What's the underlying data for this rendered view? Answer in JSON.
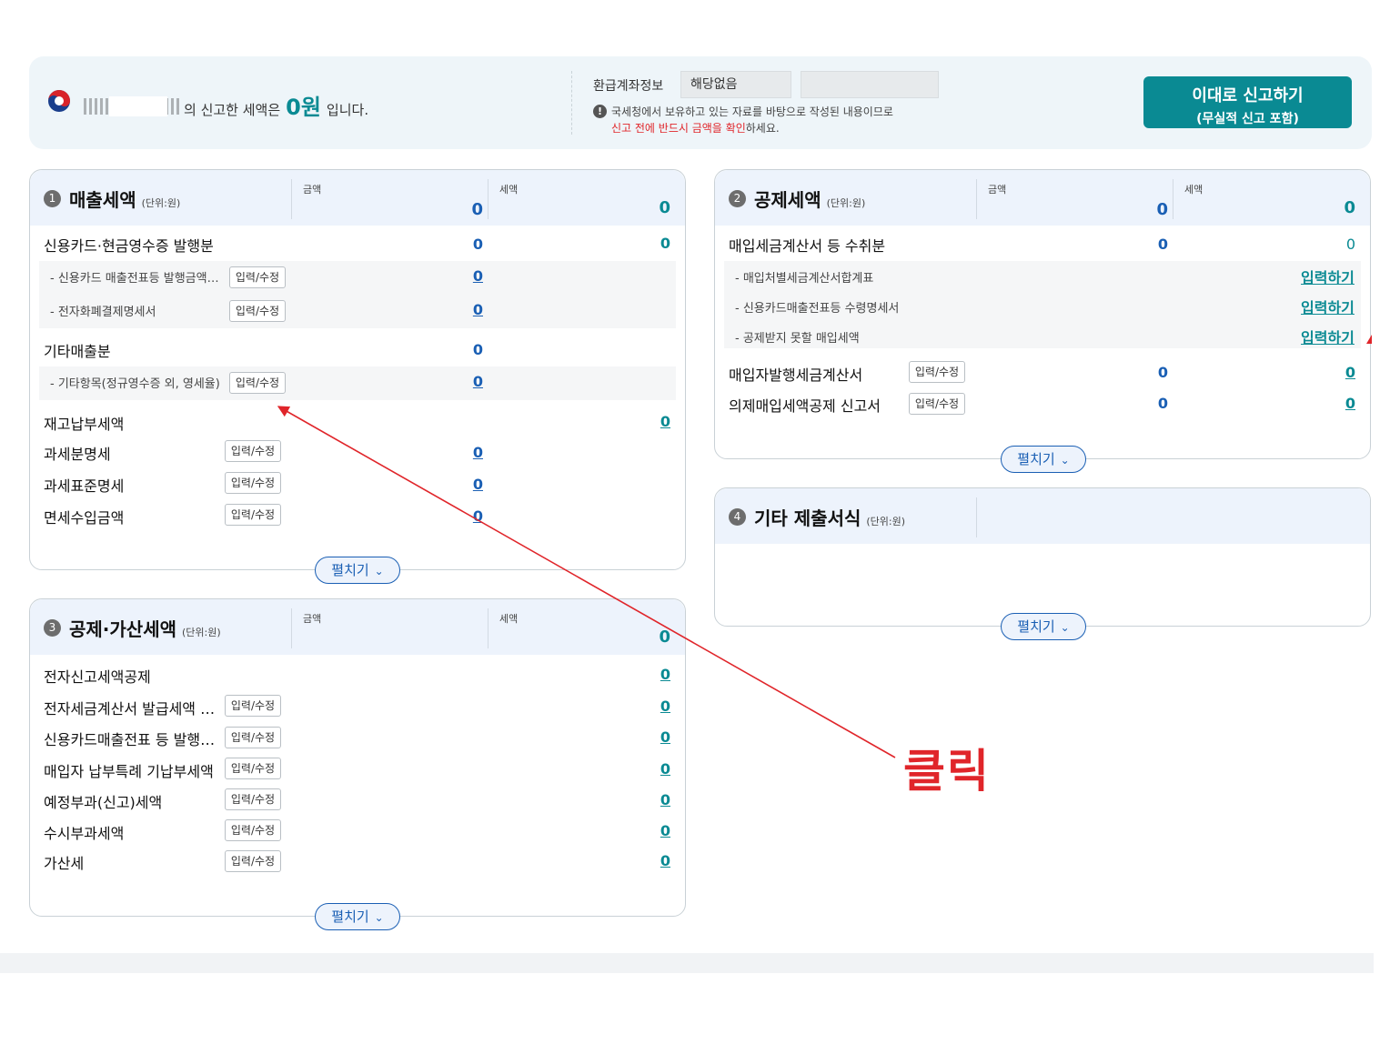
{
  "summary": {
    "name_suffix": "의 신고한 세액은",
    "amount": "0원",
    "tail": "입니다.",
    "refund_label": "환급계좌정보",
    "refund_value": "해당없음",
    "notice_line1": "국세청에서 보유하고 있는 자료를 바탕으로 작성된 내용이므로",
    "notice_line2_red": "신고 전에 반드시 금액을 확인",
    "notice_line2_tail": "하세요.",
    "submit_line1": "이대로 신고하기",
    "submit_line2": "(무실적 신고 포함)"
  },
  "panel1": {
    "badge": "1",
    "title": "매출세액",
    "unit": "(단위:원)",
    "col_amount": "금액",
    "col_tax": "세액",
    "head_amount": "0",
    "head_tax": "0",
    "rows": {
      "card": {
        "label": "신용카드·현금영수증 발행분",
        "amount": "0",
        "tax": "0"
      },
      "card_sub1": {
        "label": "- 신용카드 매출전표등 발행금액…",
        "amount": "0"
      },
      "card_sub2": {
        "label": "- 전자화폐결제명세서",
        "amount": "0"
      },
      "other": {
        "label": "기타매출분",
        "amount": "0"
      },
      "other_sub1": {
        "label": "- 기타항목(정규영수증 외, 영세율)",
        "amount": "0"
      },
      "inventory": {
        "label": "재고납부세액",
        "tax": "0"
      },
      "taxable": {
        "label": "과세분명세",
        "amount": "0"
      },
      "standard": {
        "label": "과세표준명세",
        "amount": "0"
      },
      "exempt": {
        "label": "면세수입금액",
        "amount": "0"
      }
    },
    "edit_label": "입력/수정",
    "expand_label": "펼치기"
  },
  "panel2": {
    "badge": "2",
    "title": "공제세액",
    "unit": "(단위:원)",
    "col_amount": "금액",
    "col_tax": "세액",
    "head_amount": "0",
    "head_tax": "0",
    "rows": {
      "purchase": {
        "label": "매입세금계산서 등 수취분",
        "amount": "0",
        "tax": "0"
      },
      "sub1": {
        "label": "- 매입처별세금계산서합계표",
        "link": "입력하기"
      },
      "sub2": {
        "label": "- 신용카드매출전표등 수령명세서",
        "link": "입력하기"
      },
      "sub3": {
        "label": "- 공제받지 못할 매입세액",
        "link": "입력하기"
      },
      "buyer": {
        "label": "매입자발행세금계산서",
        "amount": "0",
        "tax": "0"
      },
      "deemed": {
        "label": "의제매입세액공제 신고서",
        "amount": "0",
        "tax": "0"
      }
    },
    "edit_label": "입력/수정",
    "expand_label": "펼치기"
  },
  "panel3": {
    "badge": "3",
    "title": "공제·가산세액",
    "unit": "(단위:원)",
    "col_amount": "금액",
    "col_tax": "세액",
    "head_tax": "0",
    "rows": [
      {
        "label": "전자신고세액공제",
        "tax": "0",
        "edit": false
      },
      {
        "label": "전자세금계산서 발급세액 …",
        "tax": "0",
        "edit": true
      },
      {
        "label": "신용카드매출전표 등 발행…",
        "tax": "0",
        "edit": true
      },
      {
        "label": "매입자 납부특례 기납부세액",
        "tax": "0",
        "edit": true
      },
      {
        "label": "예정부과(신고)세액",
        "tax": "0",
        "edit": true
      },
      {
        "label": "수시부과세액",
        "tax": "0",
        "edit": true
      },
      {
        "label": "가산세",
        "tax": "0",
        "edit": true
      }
    ],
    "edit_label": "입력/수정",
    "expand_label": "펼치기"
  },
  "panel4": {
    "badge": "4",
    "title": "기타 제출서식",
    "unit": "(단위:원)",
    "expand_label": "펼치기"
  },
  "annotation": {
    "text": "클릭",
    "color": "#e0252a"
  },
  "colors": {
    "accent": "#0a8a93",
    "value_blue": "#1a5fb4",
    "panel_head": "#edf3fc"
  }
}
